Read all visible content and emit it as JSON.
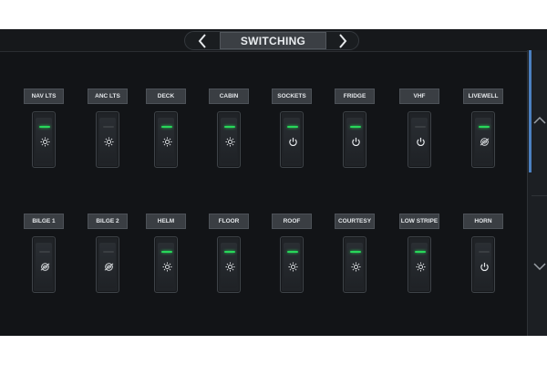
{
  "header": {
    "title": "SWITCHING",
    "prev_icon": "chevron-left-icon",
    "next_icon": "chevron-right-icon"
  },
  "colors": {
    "led_on": "#28d75a",
    "led_off": "#3a3e42",
    "scroll_accent": "#4b80c0",
    "background": "#121417"
  },
  "switches": [
    {
      "label": "NAV LTS",
      "state": "on",
      "icon": "light-icon"
    },
    {
      "label": "ANC LTS",
      "state": "off",
      "icon": "light-icon"
    },
    {
      "label": "DECK",
      "state": "on",
      "icon": "light-icon"
    },
    {
      "label": "CABIN",
      "state": "on",
      "icon": "light-icon"
    },
    {
      "label": "SOCKETS",
      "state": "on",
      "icon": "power-icon"
    },
    {
      "label": "FRIDGE",
      "state": "on",
      "icon": "power-icon"
    },
    {
      "label": "VHF",
      "state": "off",
      "icon": "power-icon"
    },
    {
      "label": "LIVEWELL",
      "state": "on",
      "icon": "pump-icon"
    },
    {
      "label": "BILGE 1",
      "state": "off",
      "icon": "pump-icon"
    },
    {
      "label": "BILGE 2",
      "state": "off",
      "icon": "pump-icon"
    },
    {
      "label": "HELM",
      "state": "on",
      "icon": "light-icon"
    },
    {
      "label": "FLOOR",
      "state": "on",
      "icon": "light-icon"
    },
    {
      "label": "ROOF",
      "state": "on",
      "icon": "light-icon"
    },
    {
      "label": "COURTESY",
      "state": "on",
      "icon": "light-icon"
    },
    {
      "label": "LOW STRIPE",
      "state": "on",
      "icon": "light-icon"
    },
    {
      "label": "HORN",
      "state": "off",
      "icon": "power-icon"
    }
  ],
  "scrollbar": {
    "up_icon": "chevron-up-icon",
    "down_icon": "chevron-down-icon"
  }
}
